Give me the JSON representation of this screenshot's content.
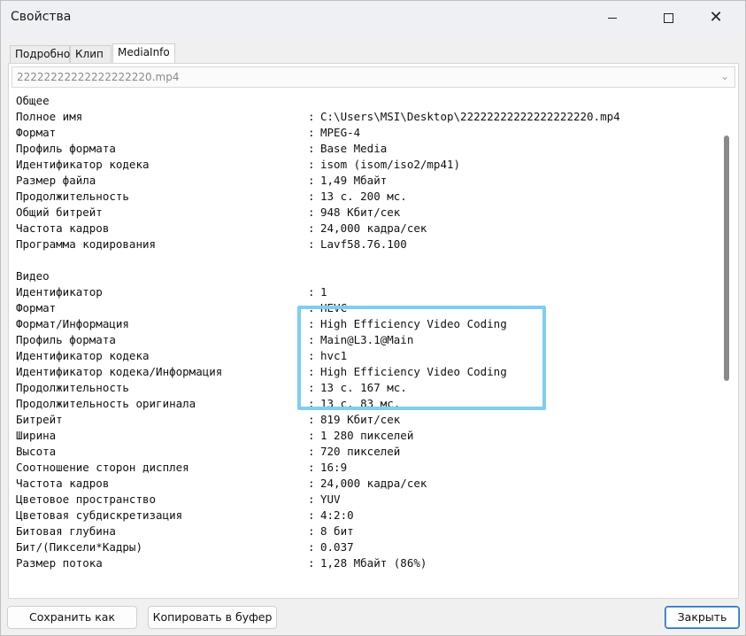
{
  "window": {
    "title": "Свойства"
  },
  "tabs": [
    {
      "label": "Подробно"
    },
    {
      "label": "Клип"
    },
    {
      "label": "MediaInfo"
    }
  ],
  "file_select": {
    "value": "22222222222222222220.mp4"
  },
  "info": {
    "sections": [
      {
        "header": "Общее",
        "rows": [
          {
            "label": "Полное имя",
            "value": "C:\\Users\\MSI\\Desktop\\22222222222222222220.mp4"
          },
          {
            "label": "Формат",
            "value": "MPEG-4"
          },
          {
            "label": "Профиль формата",
            "value": "Base Media"
          },
          {
            "label": "Идентификатор кодека",
            "value": "isom (isom/iso2/mp41)"
          },
          {
            "label": "Размер файла",
            "value": "1,49 Мбайт"
          },
          {
            "label": "Продолжительность",
            "value": "13 с. 200 мс."
          },
          {
            "label": "Общий битрейт",
            "value": "948 Кбит/сек"
          },
          {
            "label": "Частота кадров",
            "value": "24,000 кадра/сек"
          },
          {
            "label": "Программа кодирования",
            "value": "Lavf58.76.100"
          }
        ]
      },
      {
        "header": "Видео",
        "rows": [
          {
            "label": "Идентификатор",
            "value": "1"
          },
          {
            "label": "Формат",
            "value": "HEVC"
          },
          {
            "label": "Формат/Информация",
            "value": "High Efficiency Video Coding"
          },
          {
            "label": "Профиль формата",
            "value": "Main@L3.1@Main"
          },
          {
            "label": "Идентификатор кодека",
            "value": "hvc1"
          },
          {
            "label": "Идентификатор кодека/Информация",
            "value": "High Efficiency Video Coding"
          },
          {
            "label": "Продолжительность",
            "value": "13 с. 167 мс."
          },
          {
            "label": "Продолжительность оригинала",
            "value": "13 с. 83 мс."
          },
          {
            "label": "Битрейт",
            "value": "819 Кбит/сек"
          },
          {
            "label": "Ширина",
            "value": "1 280 пикселей"
          },
          {
            "label": "Высота",
            "value": "720 пикселей"
          },
          {
            "label": "Соотношение сторон дисплея",
            "value": "16:9"
          },
          {
            "label": "Частота кадров",
            "value": "24,000 кадра/сек"
          },
          {
            "label": "Цветовое пространство",
            "value": "YUV"
          },
          {
            "label": "Цветовая субдискретизация",
            "value": "4:2:0"
          },
          {
            "label": "Битовая глубина",
            "value": "8 бит"
          },
          {
            "label": "Бит/(Пиксели*Кадры)",
            "value": "0.037"
          },
          {
            "label": "Размер потока",
            "value": "1,28 Мбайт (86%)"
          }
        ]
      }
    ]
  },
  "buttons": {
    "save": "Сохранить как",
    "copy": "Копировать в буфер",
    "close": "Закрыть"
  },
  "colors": {
    "highlight": "#7fcdf1",
    "default_button_border": "#2a6fb8"
  },
  "icons": {
    "minimize": "minimize-icon",
    "maximize": "maximize-icon",
    "close": "close-icon",
    "dropdown": "chevron-down-icon"
  }
}
